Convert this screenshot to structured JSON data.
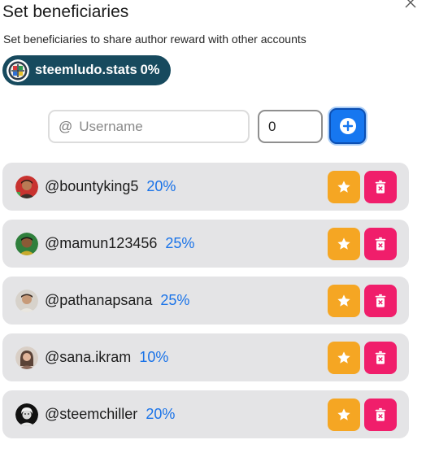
{
  "dialog": {
    "title": "Set beneficiaries",
    "subtitle": "Set beneficiaries to share author reward with other accounts"
  },
  "author": {
    "name": "steemludo.stats",
    "weight": "0%"
  },
  "form": {
    "at_symbol": "@",
    "username_placeholder": "Username",
    "username_value": "",
    "weight_value": "0"
  },
  "beneficiaries": [
    {
      "username": "@bountyking5",
      "weight": "20%"
    },
    {
      "username": "@mamun123456",
      "weight": "25%"
    },
    {
      "username": "@pathanapsana",
      "weight": "25%"
    },
    {
      "username": "@sana.ikram",
      "weight": "10%"
    },
    {
      "username": "@steemchiller",
      "weight": "20%"
    }
  ],
  "colors": {
    "chip_bg": "#174a5e",
    "add_button": "#1677f0",
    "star_button": "#f5a623",
    "delete_button": "#f01e6b",
    "weight_text": "#1a73e8",
    "row_bg": "#e4e4e6"
  },
  "icons": {
    "close": "close-icon",
    "add": "plus-circle-icon",
    "star": "star-icon",
    "delete": "trash-icon"
  }
}
